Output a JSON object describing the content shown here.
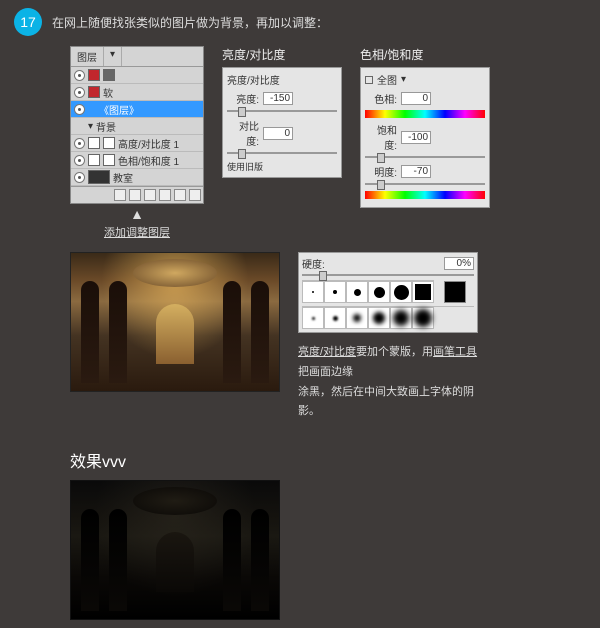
{
  "step": {
    "number": "17"
  },
  "intro": "在网上随便找张类似的图片做为背景，再加以调整：",
  "layers": {
    "tab1": "图层",
    "rows": [
      {
        "label": ""
      },
      {
        "label": "软"
      },
      {
        "label": "《图层》"
      },
      {
        "label": "背景"
      },
      {
        "label": "高度/对比度 1"
      },
      {
        "label": "色相/饱和度 1"
      },
      {
        "label": "教室"
      }
    ],
    "arrow_caption": "添加调整图层"
  },
  "brightness": {
    "title": "亮度/对比度",
    "header": "亮度/对比度",
    "r1_label": "亮度:",
    "r1_val": "-150",
    "r2_label": "对比度:",
    "r2_val": "0",
    "footer": "使用旧版"
  },
  "hue": {
    "title": "色相/饱和度",
    "preset": "全图",
    "r1_label": "色相:",
    "r1_val": "0",
    "r2_label": "饱和度:",
    "r2_val": "-100",
    "r3_label": "明度:",
    "r3_val": "-70"
  },
  "brush": {
    "label": "硬度:",
    "val": "0%"
  },
  "desc": {
    "u1": "亮度/对比度",
    "t1": "要加个蒙版，用",
    "u2": "画笔工具",
    "t2": "把画面边缘",
    "t3": "涂黑，然后在中间大致画上字体的阴影。"
  },
  "effect": {
    "title": "效果vvv"
  }
}
